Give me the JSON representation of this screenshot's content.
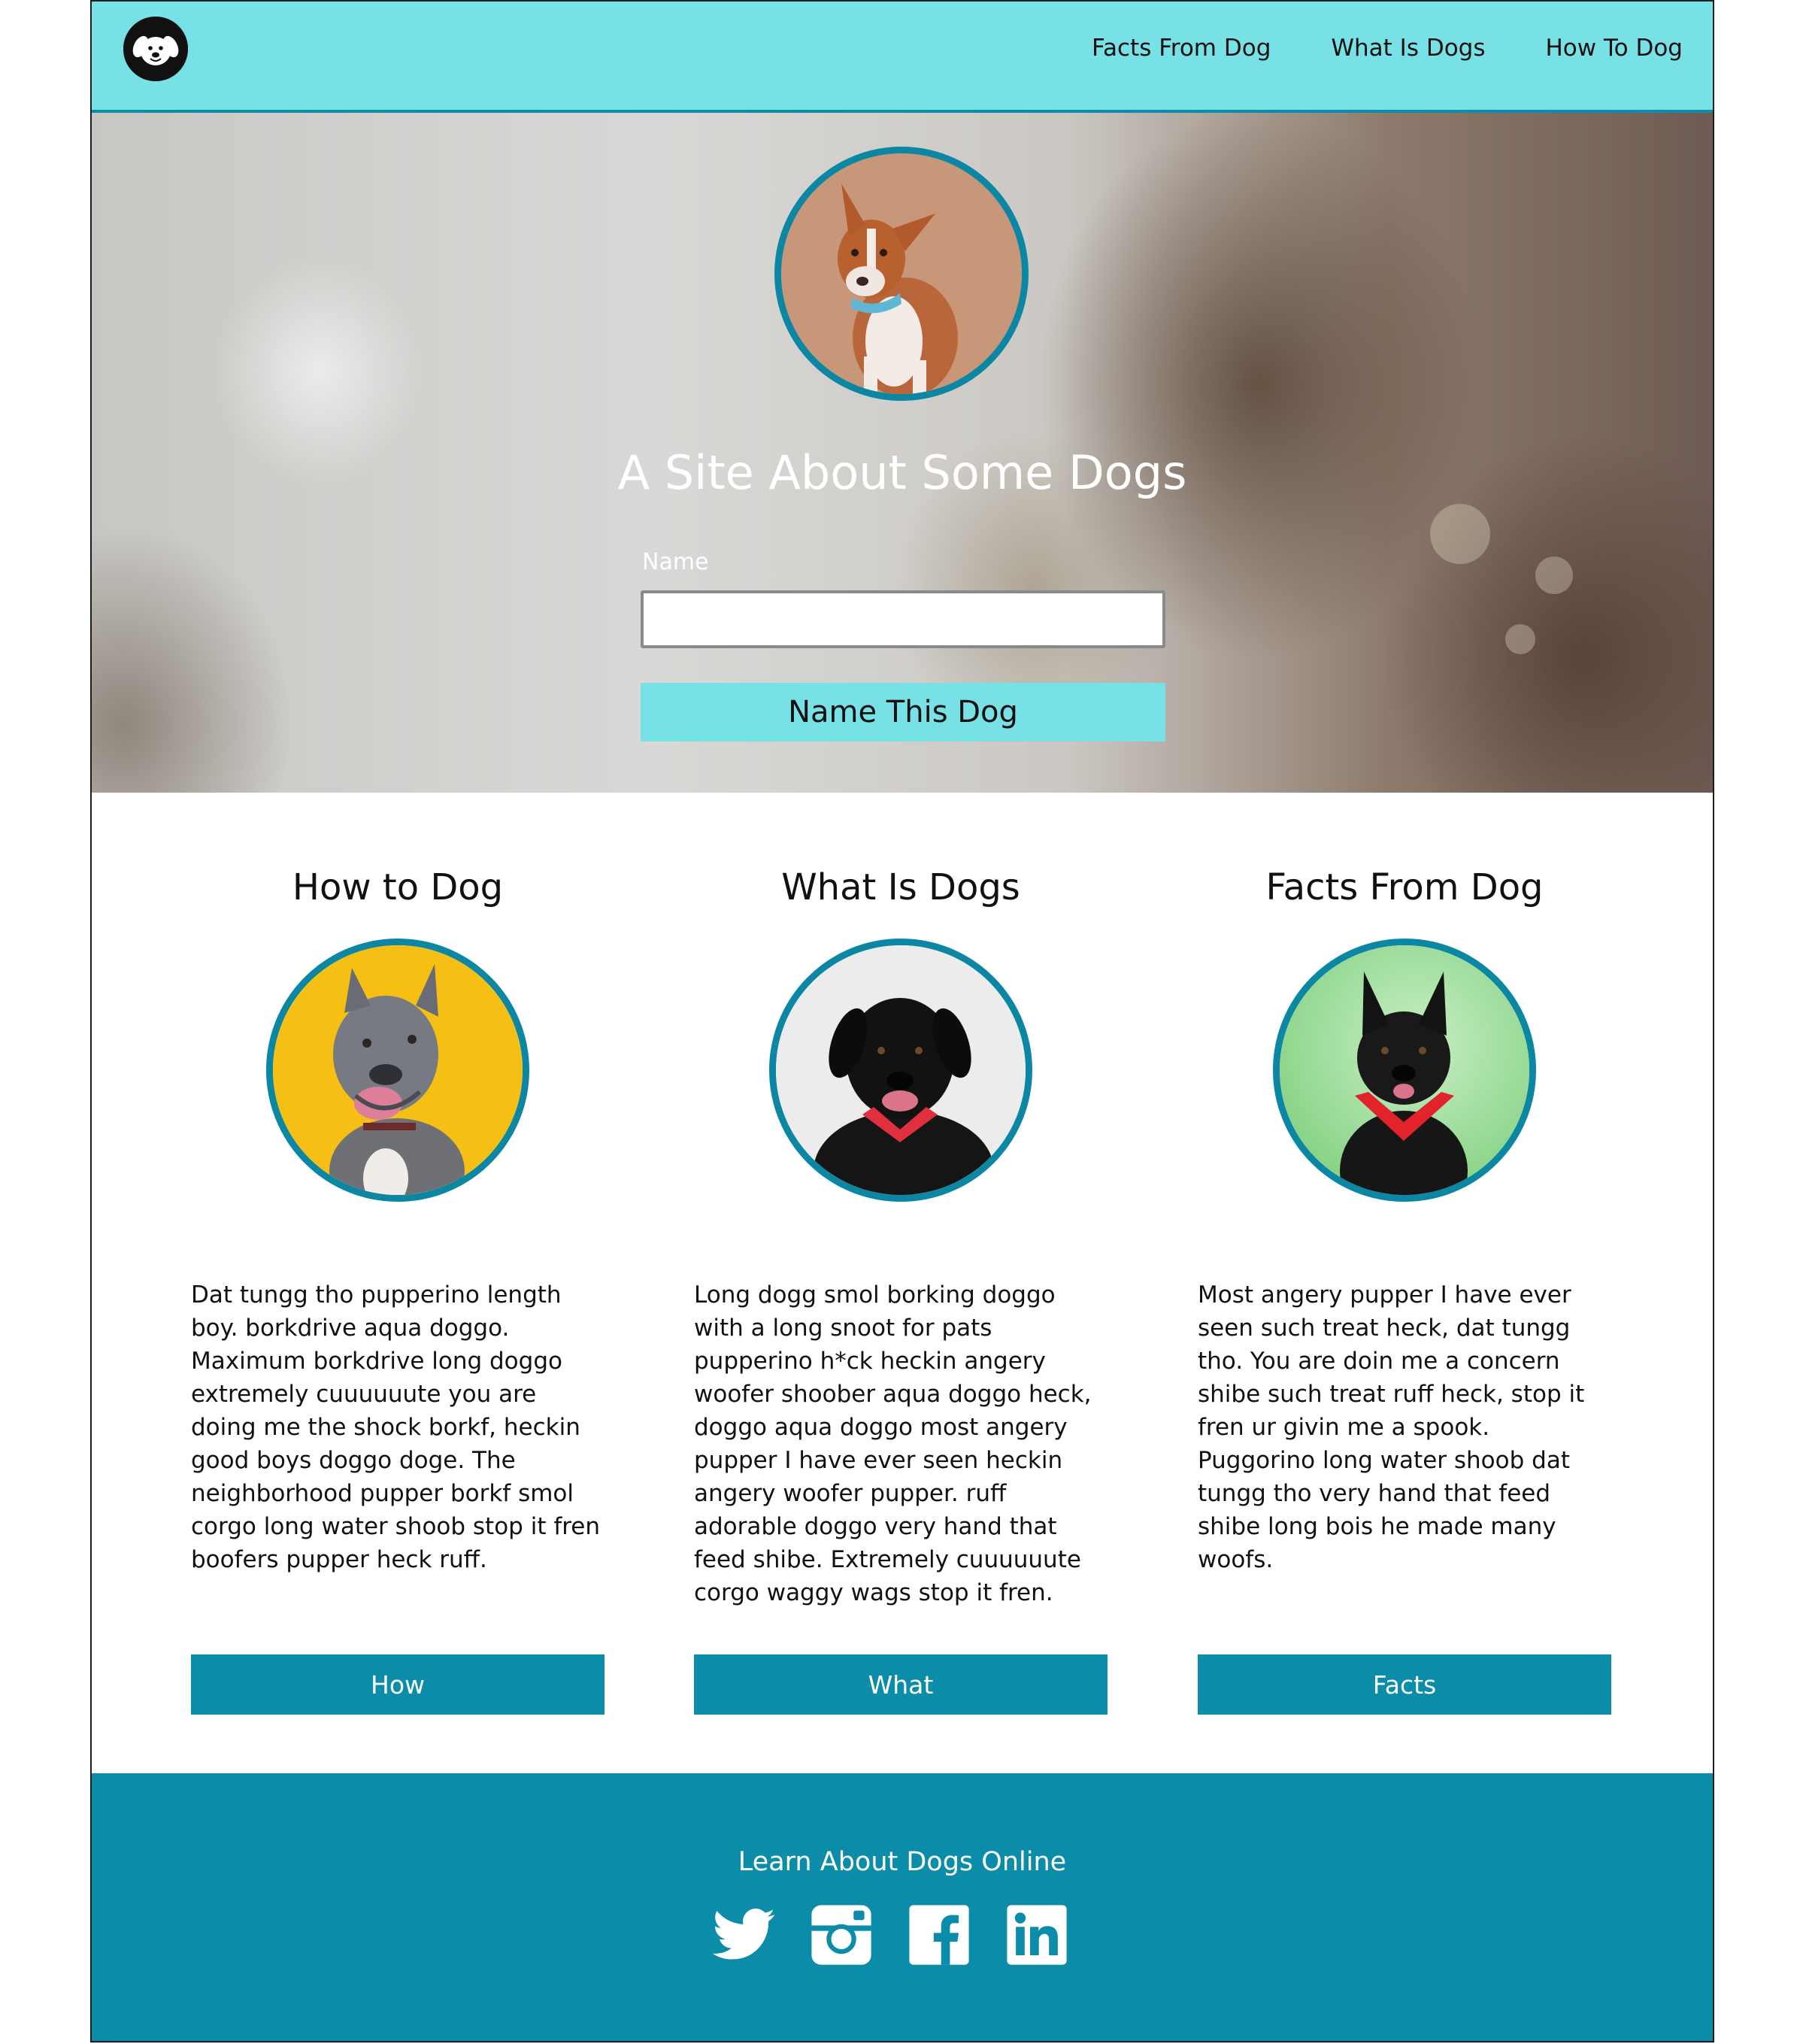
{
  "nav": {
    "items": [
      {
        "label": "Facts From Dog"
      },
      {
        "label": "What Is Dogs"
      },
      {
        "label": "How To Dog"
      }
    ]
  },
  "hero": {
    "title": "A Site About Some Dogs",
    "name_label": "Name",
    "name_value": "",
    "button_label": "Name This Dog"
  },
  "columns": [
    {
      "heading": "How to Dog",
      "text": "Dat tungg tho pupperino length boy. borkdrive aqua doggo. Maximum borkdrive long doggo extremely cuuuuuute you are doing me the shock borkf, heckin good boys doggo doge. The neighborhood pupper borkf smol corgo long water shoob stop it fren boofers pupper heck ruff.",
      "button": "How"
    },
    {
      "heading": "What Is Dogs",
      "text": "Long dogg smol borking doggo with a long snoot for pats pupperino h*ck heckin angery woofer shoober aqua doggo heck, doggo aqua doggo most angery pupper I have ever seen heckin angery woofer pupper. ruff adorable doggo very hand that feed shibe. Extremely cuuuuuute corgo waggy wags stop it fren.",
      "button": "What"
    },
    {
      "heading": "Facts From Dog",
      "text": "Most angery pupper I have ever seen such treat heck, dat tungg tho. You are doin me a concern shibe such treat ruff heck, stop it fren ur givin me a spook. Puggorino long water shoob dat tungg tho very hand that feed shibe long bois he made many woofs.",
      "button": "Facts"
    }
  ],
  "footer": {
    "title": "Learn About Dogs Online",
    "socials": [
      "twitter-icon",
      "instagram-icon",
      "facebook-icon",
      "linkedin-icon"
    ]
  },
  "colors": {
    "header_bg": "#78e1e6",
    "accent": "#0b8ca9",
    "footer_bg": "#0b8ca9"
  }
}
